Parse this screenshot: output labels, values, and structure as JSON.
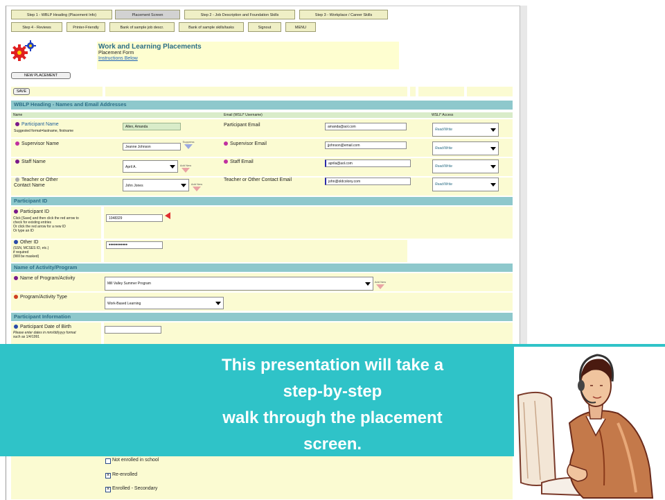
{
  "nav": {
    "row1": [
      "Step 1 - WBLP Heading (Placement Info)",
      "Placement Screen",
      "Step 2 - Job Description and Foundation Skills",
      "Step 3 - Workplace / Career Skills"
    ],
    "row2": [
      "Step 4 - Reviews",
      "Printer-Friendly",
      "Bank of sample job descr.",
      "Bank of sample skills/tasks",
      "Signout",
      "MENU"
    ]
  },
  "header": {
    "title": "Work and Learning Placements",
    "subtitle": "Placement Form",
    "instructions_link": "Instructions Below"
  },
  "buttons": {
    "new_placement": "NEW PLACEMENT",
    "save": "SAVE"
  },
  "section_wblp": {
    "heading": "WBLP Heading - Names and Email Addresses",
    "col_name": "Name",
    "col_email": "Email (WSLI* Username)",
    "col_access": "WSLI* Access",
    "participant": {
      "label": "Participant Name",
      "note": "Suggested format=lastname, firstname",
      "value": "Allen, Amanda",
      "email_label": "Participant Email",
      "email": "amanda@aol.com",
      "access": "Read/Write"
    },
    "supervisor": {
      "label": "Supervisor Name",
      "value": "Jeanne Johnson",
      "add_label": "Suppress",
      "email_label": "Supervisor Email",
      "email": "jjohnson@email.com",
      "access": "Read/Write"
    },
    "staff": {
      "label": "Staff Name",
      "value": "April A.",
      "add_label": "Add New",
      "email_label": "Staff Email",
      "email": "aprila@aol.com",
      "access": "Read/Write"
    },
    "teacher": {
      "label": "Teacher or Other",
      "label2": "Contact Name",
      "value": "John Jones",
      "add_label": "Add New",
      "email_label": "Teacher or Other Contact Email",
      "email": "john@oldcolony.com",
      "access": "Read/Write"
    }
  },
  "section_pid": {
    "heading": "Participant ID",
    "pid_label": "Participant ID",
    "pid_note": [
      "Click [Save] and then click the red arrow to",
      "check for existing entries",
      "Or click the red arrow for a new ID",
      "Or type an ID"
    ],
    "pid_value": "1048329",
    "other_label": "Other ID",
    "other_note": [
      "(SSN, MCSES ID, etc.)",
      "if required",
      "(Will be masked)"
    ],
    "other_value": "•••••••••••"
  },
  "section_activity": {
    "heading": "Name of Activity/Program",
    "program_label": "Name of Program/Activity",
    "program_value": "Mill Valley Summer Program",
    "add_label": "Add New",
    "type_label": "Program/Activity Type",
    "type_value": "Work-Based Learning"
  },
  "section_info": {
    "heading": "Participant Information",
    "dob_label": "Participant Date of Birth",
    "dob_note": [
      "Please enter dates in mm/dd/yyyy format",
      "such as 1/4/1991"
    ]
  },
  "enrollment": [
    {
      "label": "Not enrolled in school",
      "checked": false
    },
    {
      "label": "Re-enrolled",
      "checked": true
    },
    {
      "label": "Enrolled - Secondary",
      "checked": true
    }
  ],
  "banner": {
    "lines": [
      "This presentation will take a",
      "step-by-step",
      "walk through the placement",
      "screen."
    ]
  },
  "colors": {
    "banner": "#2fc3c8",
    "section": "#8ec8cc",
    "cell": "#fbfbd2",
    "title": "#2c6e86"
  }
}
